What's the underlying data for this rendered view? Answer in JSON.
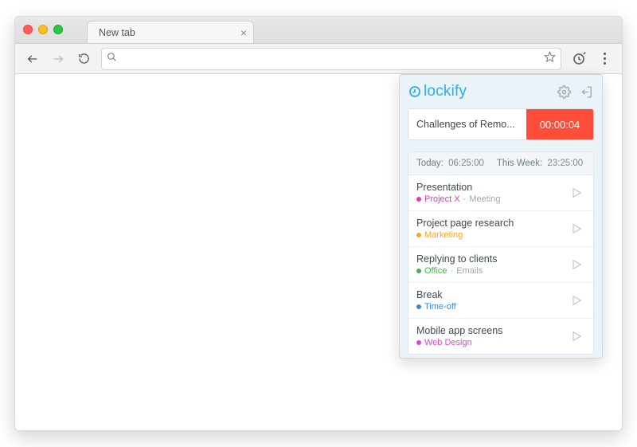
{
  "browser": {
    "tab_title": "New tab",
    "omnibox_value": ""
  },
  "popup": {
    "brand": "lockify",
    "timer": {
      "description": "Challenges of Remo...",
      "elapsed": "00:00:04"
    },
    "summary": {
      "today_label": "Today:",
      "today_value": "06:25:00",
      "week_label": "This Week:",
      "week_value": "23:25:00"
    },
    "entries": [
      {
        "title": "Presentation",
        "project": "Project X",
        "task": "Meeting",
        "color": "#d63fb8"
      },
      {
        "title": "Project page research",
        "project": "Marketing",
        "task": "",
        "color": "#f5a623"
      },
      {
        "title": "Replying to clients",
        "project": "Office",
        "task": "Emails",
        "color": "#4caf50"
      },
      {
        "title": "Break",
        "project": "Time-off",
        "task": "",
        "color": "#3b8bd6"
      },
      {
        "title": "Mobile app screens",
        "project": "Web Design",
        "task": "",
        "color": "#d24dc7"
      }
    ]
  }
}
